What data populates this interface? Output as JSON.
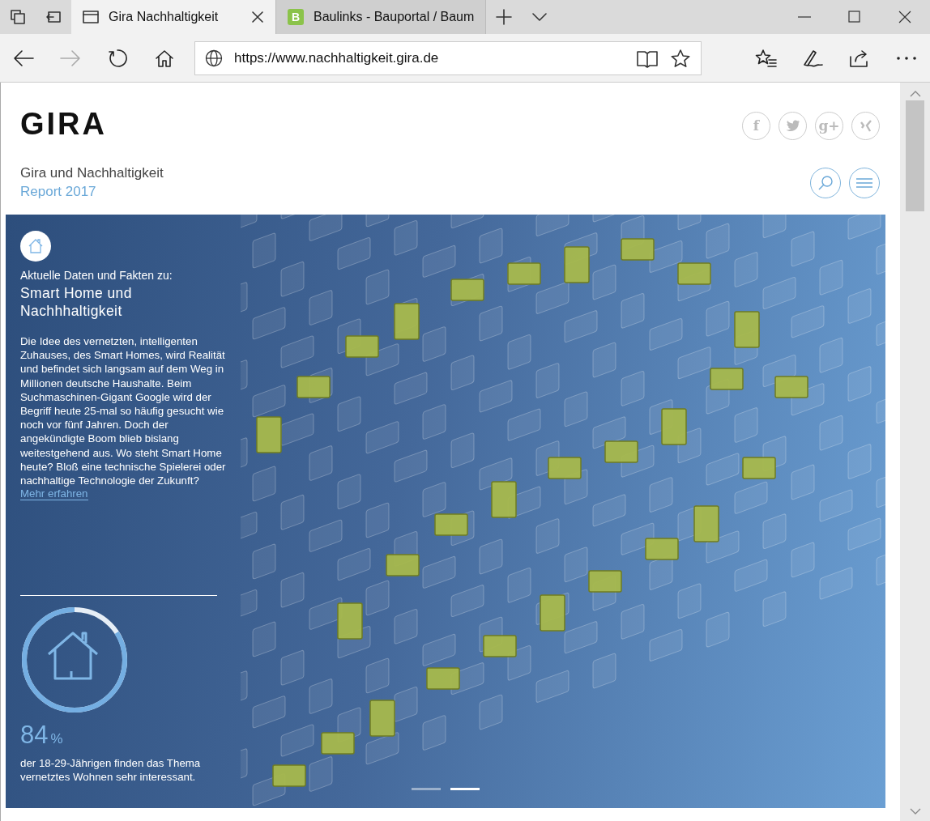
{
  "browser": {
    "tabs": [
      {
        "title": "Gira Nachhaltigkeit",
        "kind": "page",
        "selected": true
      },
      {
        "title": "Baulinks - Bauportal / Baum",
        "kind": "favicon",
        "favicon": "B",
        "selected": false
      }
    ],
    "address": "https://www.nachhaltigkeit.gira.de"
  },
  "site": {
    "logo": "GIRA",
    "social": [
      {
        "kind": "facebook",
        "glyph": "f"
      },
      {
        "kind": "twitter"
      },
      {
        "kind": "googleplus",
        "glyph": "g+"
      },
      {
        "kind": "xing"
      }
    ],
    "subtitle": "Gira und Nachhaltigkeit",
    "report": "Report 2017"
  },
  "hero": {
    "intro": "Aktuelle Daten und Fakten zu:",
    "heading": "Smart Home und Nachhhaltigkeit",
    "body": "Die Idee des vernetzten, intelligenten Zuhauses, des Smart Homes, wird Realität und befindet sich langsam auf dem Weg in Millionen deutsche Haushalte. Beim Suchmaschinen-Gigant Google wird der Begriff heute 25-mal so häufig gesucht wie noch vor fünf Jahren. Doch der angekündigte Boom blieb bislang weitestgehend aus. Wo steht Smart Home heute? Bloß eine technische Spielerei oder nachhaltige Technologie der Zukunft?",
    "link": "Mehr erfahren",
    "stat": {
      "value": "84",
      "unit": "%",
      "level": 0.84,
      "caption": "der 18-29-Jährigen finden das Thema vernetztes Wohnen sehr interessant."
    },
    "slides": [
      {
        "selected": false
      },
      {
        "selected": true
      }
    ]
  }
}
